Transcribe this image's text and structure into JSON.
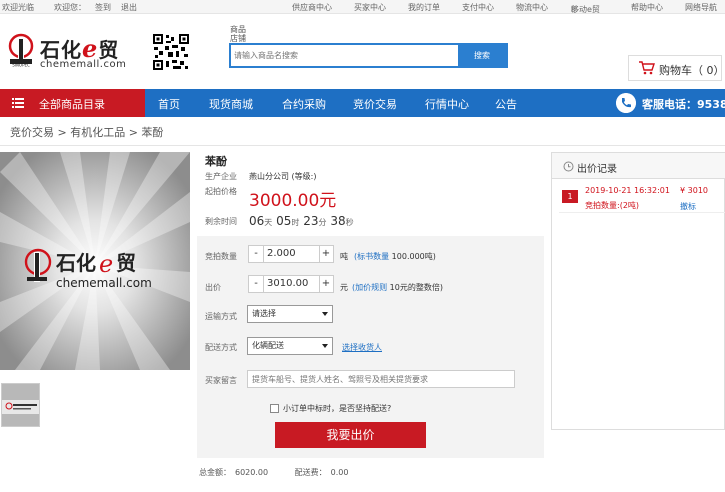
{
  "topbar": {
    "left": [
      "欢迎光临",
      "欢迎您：",
      "签到",
      "退出"
    ],
    "right": [
      "供应商中心",
      "买家中心",
      "我的订单",
      "支付中心",
      "物流中心",
      "移动e贸",
      "帮助中心",
      "网络导航"
    ]
  },
  "header": {
    "logo_cn_prefix": "石化",
    "logo_e": "e",
    "logo_cn_suffix": "贸",
    "logo_url": "chememall.com",
    "search_tab_1": "商品",
    "search_tab_2": "店铺",
    "search_placeholder": "请输入商品名搜索",
    "search_button": "搜索",
    "cart_label": "购物车（ 0）"
  },
  "nav": {
    "category_label": "全部商品目录",
    "items": [
      "首页",
      "现货商城",
      "合约采购",
      "竞价交易",
      "行情中心",
      "公告"
    ],
    "hotline": "客服电话：9538"
  },
  "breadcrumb": "竞价交易 > 有机化工品 > 苯酚",
  "product": {
    "name": "苯酚",
    "producer_label": "生产企业",
    "producer_value": "燕山分公司 (等级:)",
    "start_price_label": "起拍价格",
    "start_price": "3000.00元",
    "remaining_label": "剩余时间",
    "countdown": {
      "days": "06",
      "d_unit": "天",
      "hours": "05",
      "h_unit": "时",
      "minutes": "23",
      "m_unit": "分",
      "seconds": "38",
      "s_unit": "秒"
    }
  },
  "panel": {
    "qty_label": "竞拍数量",
    "qty_value": "2.000",
    "qty_unit": "吨",
    "qty_note_link": "(标书数量",
    "qty_note": " 100.000吨)",
    "price_label": "出价",
    "price_value": "3010.00",
    "price_unit": "元",
    "price_note_link": "(加价规则",
    "price_note": " 10元的整数倍)",
    "transport_label": "运输方式",
    "transport_value": "请选择",
    "delivery_label": "配送方式",
    "delivery_value": "化辆配送",
    "delivery_link": "选择收货人",
    "memo_label": "买家留言",
    "memo_placeholder": "提货车船号、提货人姓名、驾照号及相关提货要求",
    "checkbox_label": "小订单中标时，是否坚持配送?",
    "bid_button": "我要出价",
    "step_minus": "-",
    "step_plus": "+"
  },
  "totals": {
    "total_label": "总金额：",
    "total_value": "6020.00",
    "fee_label": "配送费：",
    "fee_value": "0.00"
  },
  "bid_record": {
    "title": "出价记录",
    "rows": [
      {
        "rank": "1",
        "time": "2019-10-21 16:32:01",
        "price": "¥ 3010",
        "qty": "竞拍数量:(2吨)",
        "action": "撤标"
      }
    ]
  },
  "colors": {
    "brand_red": "#c81a23",
    "nav_blue": "#1e6fc3",
    "price_red": "#d0121b"
  }
}
